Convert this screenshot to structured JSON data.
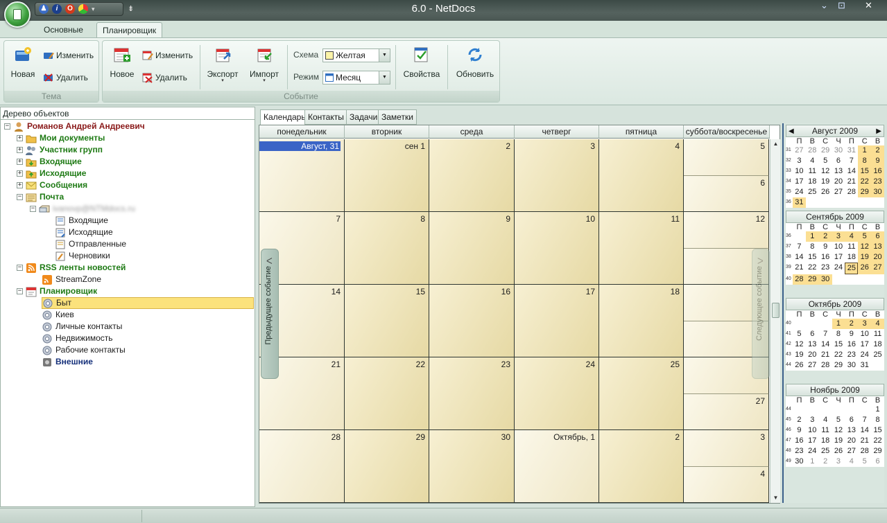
{
  "window": {
    "title": "6.0 - NetDocs"
  },
  "ribbon_tabs": [
    {
      "label": "Основные"
    },
    {
      "label": "Планировщик"
    }
  ],
  "ribbon": {
    "theme_group": {
      "label": "Тема",
      "new": "Новая",
      "edit": "Изменить",
      "delete": "Удалить"
    },
    "event_group": {
      "label": "Событие",
      "new": "Новое",
      "edit": "Изменить",
      "delete": "Удалить",
      "export": "Экспорт",
      "import": "Импорт",
      "scheme_label": "Схема",
      "scheme_value": "Желтая",
      "mode_label": "Режим",
      "mode_value": "Месяц",
      "properties": "Свойства",
      "refresh": "Обновить"
    }
  },
  "tree": {
    "header": "Дерево объектов",
    "root": "Романов Андрей Андреевич",
    "items": [
      "Мои документы",
      "Участник групп",
      "Входящие",
      "Исходящие",
      "Сообщения",
      "Почта"
    ],
    "mail_account": "ivanovp@NTMdocs.ru",
    "mail_folders": [
      "Входящие",
      "Исходящие",
      "Отправленные",
      "Черновики"
    ],
    "rss": "RSS ленты новостей",
    "rss_feed": "StreamZone",
    "planner": "Планировщик",
    "planner_items": [
      "Быт",
      "Киев",
      "Личные контакты",
      "Недвижимость",
      "Рабочие контакты"
    ],
    "external": "Внешние"
  },
  "content_tabs": [
    "Календарь",
    "Контакты",
    "Задачи",
    "Заметки"
  ],
  "calendar": {
    "weekdays": [
      "понедельник",
      "вторник",
      "среда",
      "четверг",
      "пятница",
      "суббота/воскресенье"
    ],
    "weeks": [
      [
        "Август, 31",
        "сен 1",
        "2",
        "3",
        "4",
        "5",
        "6"
      ],
      [
        "7",
        "8",
        "9",
        "10",
        "11",
        "12",
        ""
      ],
      [
        "14",
        "15",
        "16",
        "17",
        "18",
        "",
        ""
      ],
      [
        "21",
        "22",
        "23",
        "24",
        "25",
        "",
        "27"
      ],
      [
        "28",
        "29",
        "30",
        "Октябрь, 1",
        "2",
        "3",
        "4"
      ]
    ],
    "prev_event": "Предыдущее событие",
    "next_event": "Следующее событие"
  },
  "mini_calendars": {
    "day_names": [
      "П",
      "В",
      "С",
      "Ч",
      "П",
      "С",
      "В"
    ],
    "months": [
      {
        "title": "Август 2009",
        "weeks": [
          {
            "wk": "31",
            "days": [
              "27",
              "28",
              "29",
              "30",
              "31",
              "1",
              "2"
            ]
          },
          {
            "wk": "32",
            "days": [
              "3",
              "4",
              "5",
              "6",
              "7",
              "8",
              "9"
            ]
          },
          {
            "wk": "33",
            "days": [
              "10",
              "11",
              "12",
              "13",
              "14",
              "15",
              "16"
            ]
          },
          {
            "wk": "34",
            "days": [
              "17",
              "18",
              "19",
              "20",
              "21",
              "22",
              "23"
            ]
          },
          {
            "wk": "35",
            "days": [
              "24",
              "25",
              "26",
              "27",
              "28",
              "29",
              "30"
            ]
          },
          {
            "wk": "36",
            "days": [
              "31",
              "",
              "",
              "",
              "",
              "",
              ""
            ]
          }
        ]
      },
      {
        "title": "Сентябрь 2009",
        "weeks": [
          {
            "wk": "36",
            "days": [
              "",
              "1",
              "2",
              "3",
              "4",
              "5",
              "6"
            ]
          },
          {
            "wk": "37",
            "days": [
              "7",
              "8",
              "9",
              "10",
              "11",
              "12",
              "13"
            ]
          },
          {
            "wk": "38",
            "days": [
              "14",
              "15",
              "16",
              "17",
              "18",
              "19",
              "20"
            ]
          },
          {
            "wk": "39",
            "days": [
              "21",
              "22",
              "23",
              "24",
              "25",
              "26",
              "27"
            ]
          },
          {
            "wk": "40",
            "days": [
              "28",
              "29",
              "30",
              "",
              "",
              "",
              ""
            ]
          }
        ]
      },
      {
        "title": "Октябрь 2009",
        "weeks": [
          {
            "wk": "40",
            "days": [
              "",
              "",
              "",
              "1",
              "2",
              "3",
              "4"
            ]
          },
          {
            "wk": "41",
            "days": [
              "5",
              "6",
              "7",
              "8",
              "9",
              "10",
              "11"
            ]
          },
          {
            "wk": "42",
            "days": [
              "12",
              "13",
              "14",
              "15",
              "16",
              "17",
              "18"
            ]
          },
          {
            "wk": "43",
            "days": [
              "19",
              "20",
              "21",
              "22",
              "23",
              "24",
              "25"
            ]
          },
          {
            "wk": "44",
            "days": [
              "26",
              "27",
              "28",
              "29",
              "30",
              "31",
              ""
            ]
          }
        ]
      },
      {
        "title": "Ноябрь 2009",
        "weeks": [
          {
            "wk": "44",
            "days": [
              "",
              "",
              "",
              "",
              "",
              "",
              "1"
            ]
          },
          {
            "wk": "45",
            "days": [
              "2",
              "3",
              "4",
              "5",
              "6",
              "7",
              "8"
            ]
          },
          {
            "wk": "46",
            "days": [
              "9",
              "10",
              "11",
              "12",
              "13",
              "14",
              "15"
            ]
          },
          {
            "wk": "47",
            "days": [
              "16",
              "17",
              "18",
              "19",
              "20",
              "21",
              "22"
            ]
          },
          {
            "wk": "48",
            "days": [
              "23",
              "24",
              "25",
              "26",
              "27",
              "28",
              "29"
            ]
          },
          {
            "wk": "49",
            "days": [
              "30",
              "1",
              "2",
              "3",
              "4",
              "5",
              "6"
            ]
          }
        ]
      }
    ]
  },
  "colors": {
    "accent": "#3a64c6",
    "highlight": "#fbdf93",
    "cell": "#efe3b3",
    "tree_green": "#1e7a14"
  }
}
